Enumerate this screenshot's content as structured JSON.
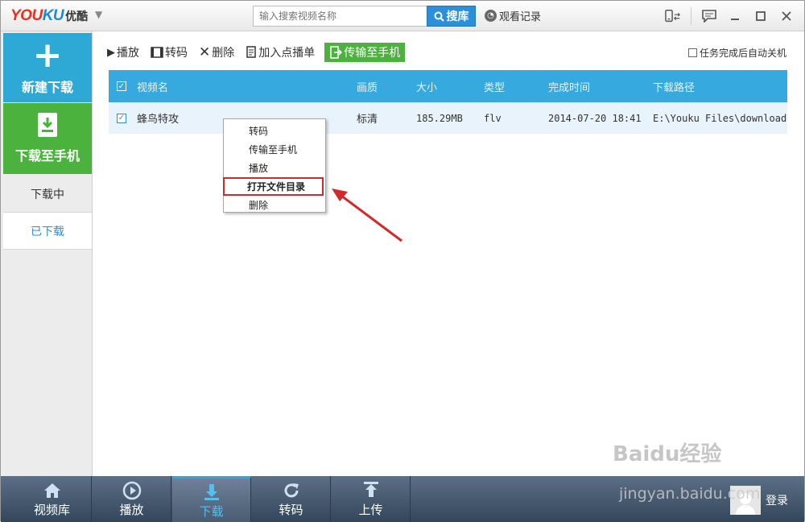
{
  "app": {
    "logo_latin": "YOUKU",
    "logo_cn": "优酷",
    "search_placeholder": "输入搜索视频名称",
    "search_button": "搜库",
    "history_label": "观看记录"
  },
  "sidebar": {
    "new_download": "新建下载",
    "download_to_phone": "下载至手机",
    "tab_downloading": "下载中",
    "tab_downloaded": "已下载"
  },
  "toolbar": {
    "play": "播放",
    "transcode": "转码",
    "delete": "删除",
    "add_playlist": "加入点播单",
    "transfer_phone": "传输至手机",
    "auto_shutdown": "任务完成后自动关机"
  },
  "table": {
    "headers": [
      "视频名",
      "画质",
      "大小",
      "类型",
      "完成时间",
      "下载路径"
    ],
    "rows": [
      {
        "name": "蜂鸟特攻",
        "quality": "标清",
        "size": "185.29MB",
        "type": "flv",
        "finished": "2014-07-20 18:41",
        "path": "E:\\Youku Files\\download\\"
      }
    ]
  },
  "context_menu": {
    "items": [
      "转码",
      "传输至手机",
      "播放",
      "打开文件目录",
      "删除"
    ],
    "highlighted_index": 3
  },
  "bottom_nav": {
    "items": [
      "视频库",
      "播放",
      "下载",
      "转码",
      "上传"
    ],
    "active_index": 2,
    "login": "登录"
  },
  "watermark": {
    "brand": "Baidu经验",
    "url": "jingyan.baidu.com"
  },
  "colors": {
    "accent_blue": "#2ea9d6",
    "green": "#4bb23d",
    "highlight_red": "#d12a2a"
  }
}
